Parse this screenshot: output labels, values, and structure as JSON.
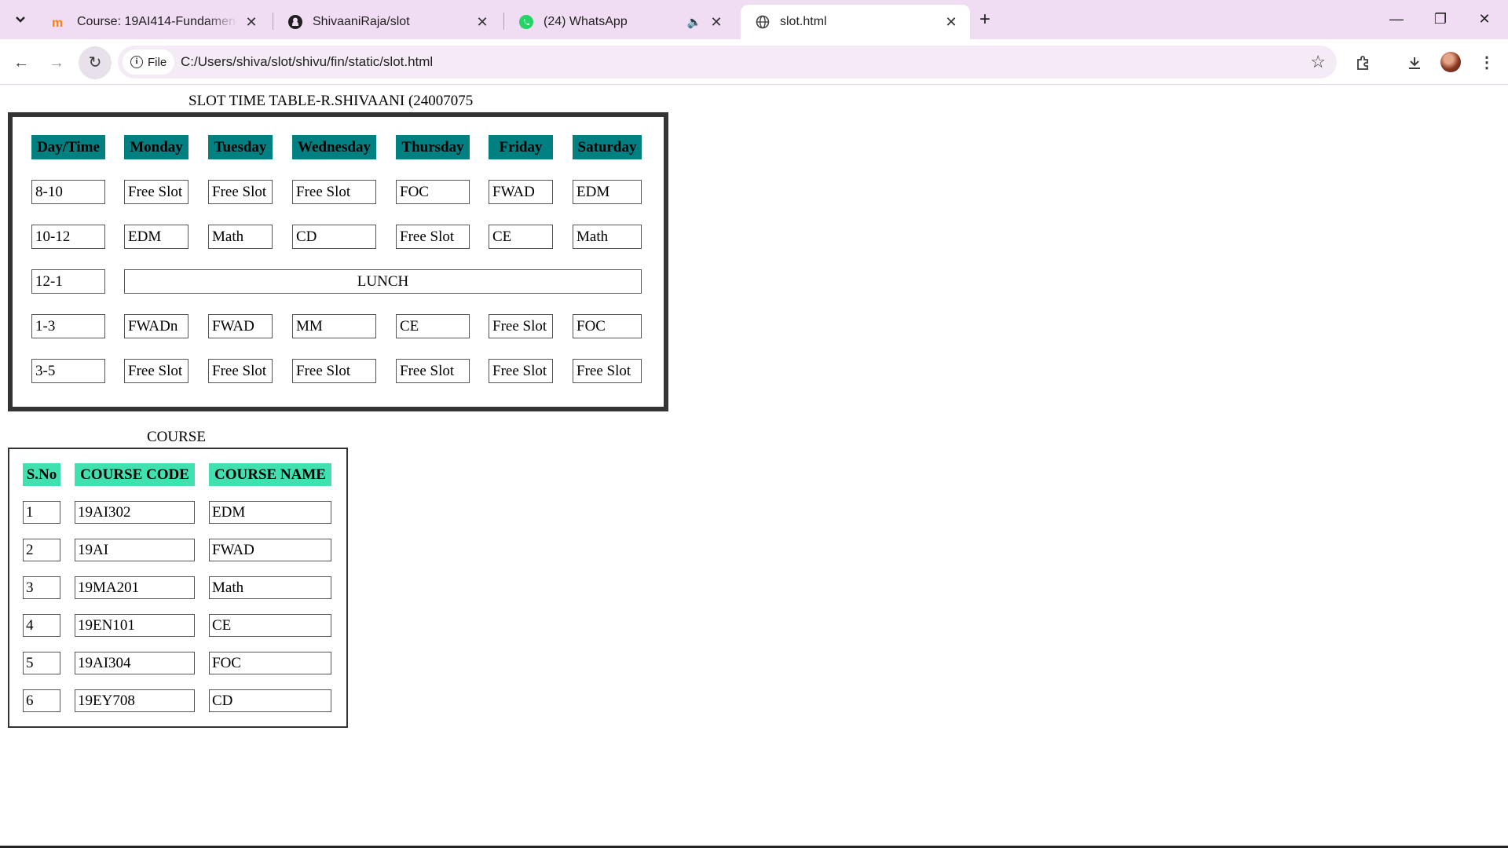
{
  "browser": {
    "tabs": [
      {
        "title": "Course: 19AI414-Fundamentals",
        "favicon": "moodle-icon"
      },
      {
        "title": "ShivaaniRaja/slot",
        "favicon": "github-icon"
      },
      {
        "title": "(24) WhatsApp",
        "favicon": "whatsapp-icon"
      },
      {
        "title": "slot.html",
        "favicon": "globe-icon"
      }
    ],
    "active_tab": 3,
    "chip_label": "File",
    "url": "C:/Users/shiva/slot/shivu/fin/static/slot.html"
  },
  "timetable": {
    "caption": "SLOT TIME TABLE-R.SHIVAANI (24007075",
    "header_color": "#008080",
    "headers": [
      "Day/Time",
      "Monday",
      "Tuesday",
      "Wednesday",
      "Thursday",
      "Friday",
      "Saturday"
    ],
    "rows": [
      {
        "time": "8-10",
        "cells": [
          "Free Slot",
          "Free Slot",
          "Free Slot",
          "FOC",
          "FWAD",
          "EDM"
        ]
      },
      {
        "time": "10-12",
        "cells": [
          "EDM",
          "Math",
          "CD",
          "Free Slot",
          "CE",
          "Math"
        ]
      },
      {
        "time": "12-1",
        "lunch": "LUNCH"
      },
      {
        "time": "1-3",
        "cells": [
          "FWADn",
          "FWAD",
          "MM",
          "CE",
          "Free Slot",
          "FOC"
        ]
      },
      {
        "time": "3-5",
        "cells": [
          "Free Slot",
          "Free Slot",
          "Free Slot",
          "Free Slot",
          "Free Slot",
          "Free Slot"
        ]
      }
    ]
  },
  "courses": {
    "caption": "COURSE",
    "header_color": "#40e0b0",
    "headers": [
      "S.No",
      "COURSE CODE",
      "COURSE NAME"
    ],
    "rows": [
      [
        "1",
        "19AI302",
        "EDM"
      ],
      [
        "2",
        "19AI",
        "FWAD"
      ],
      [
        "3",
        "19MA201",
        "Math"
      ],
      [
        "4",
        "19EN101",
        "CE"
      ],
      [
        "5",
        "19AI304",
        "FOC"
      ],
      [
        "6",
        "19EY708",
        "CD"
      ]
    ]
  }
}
